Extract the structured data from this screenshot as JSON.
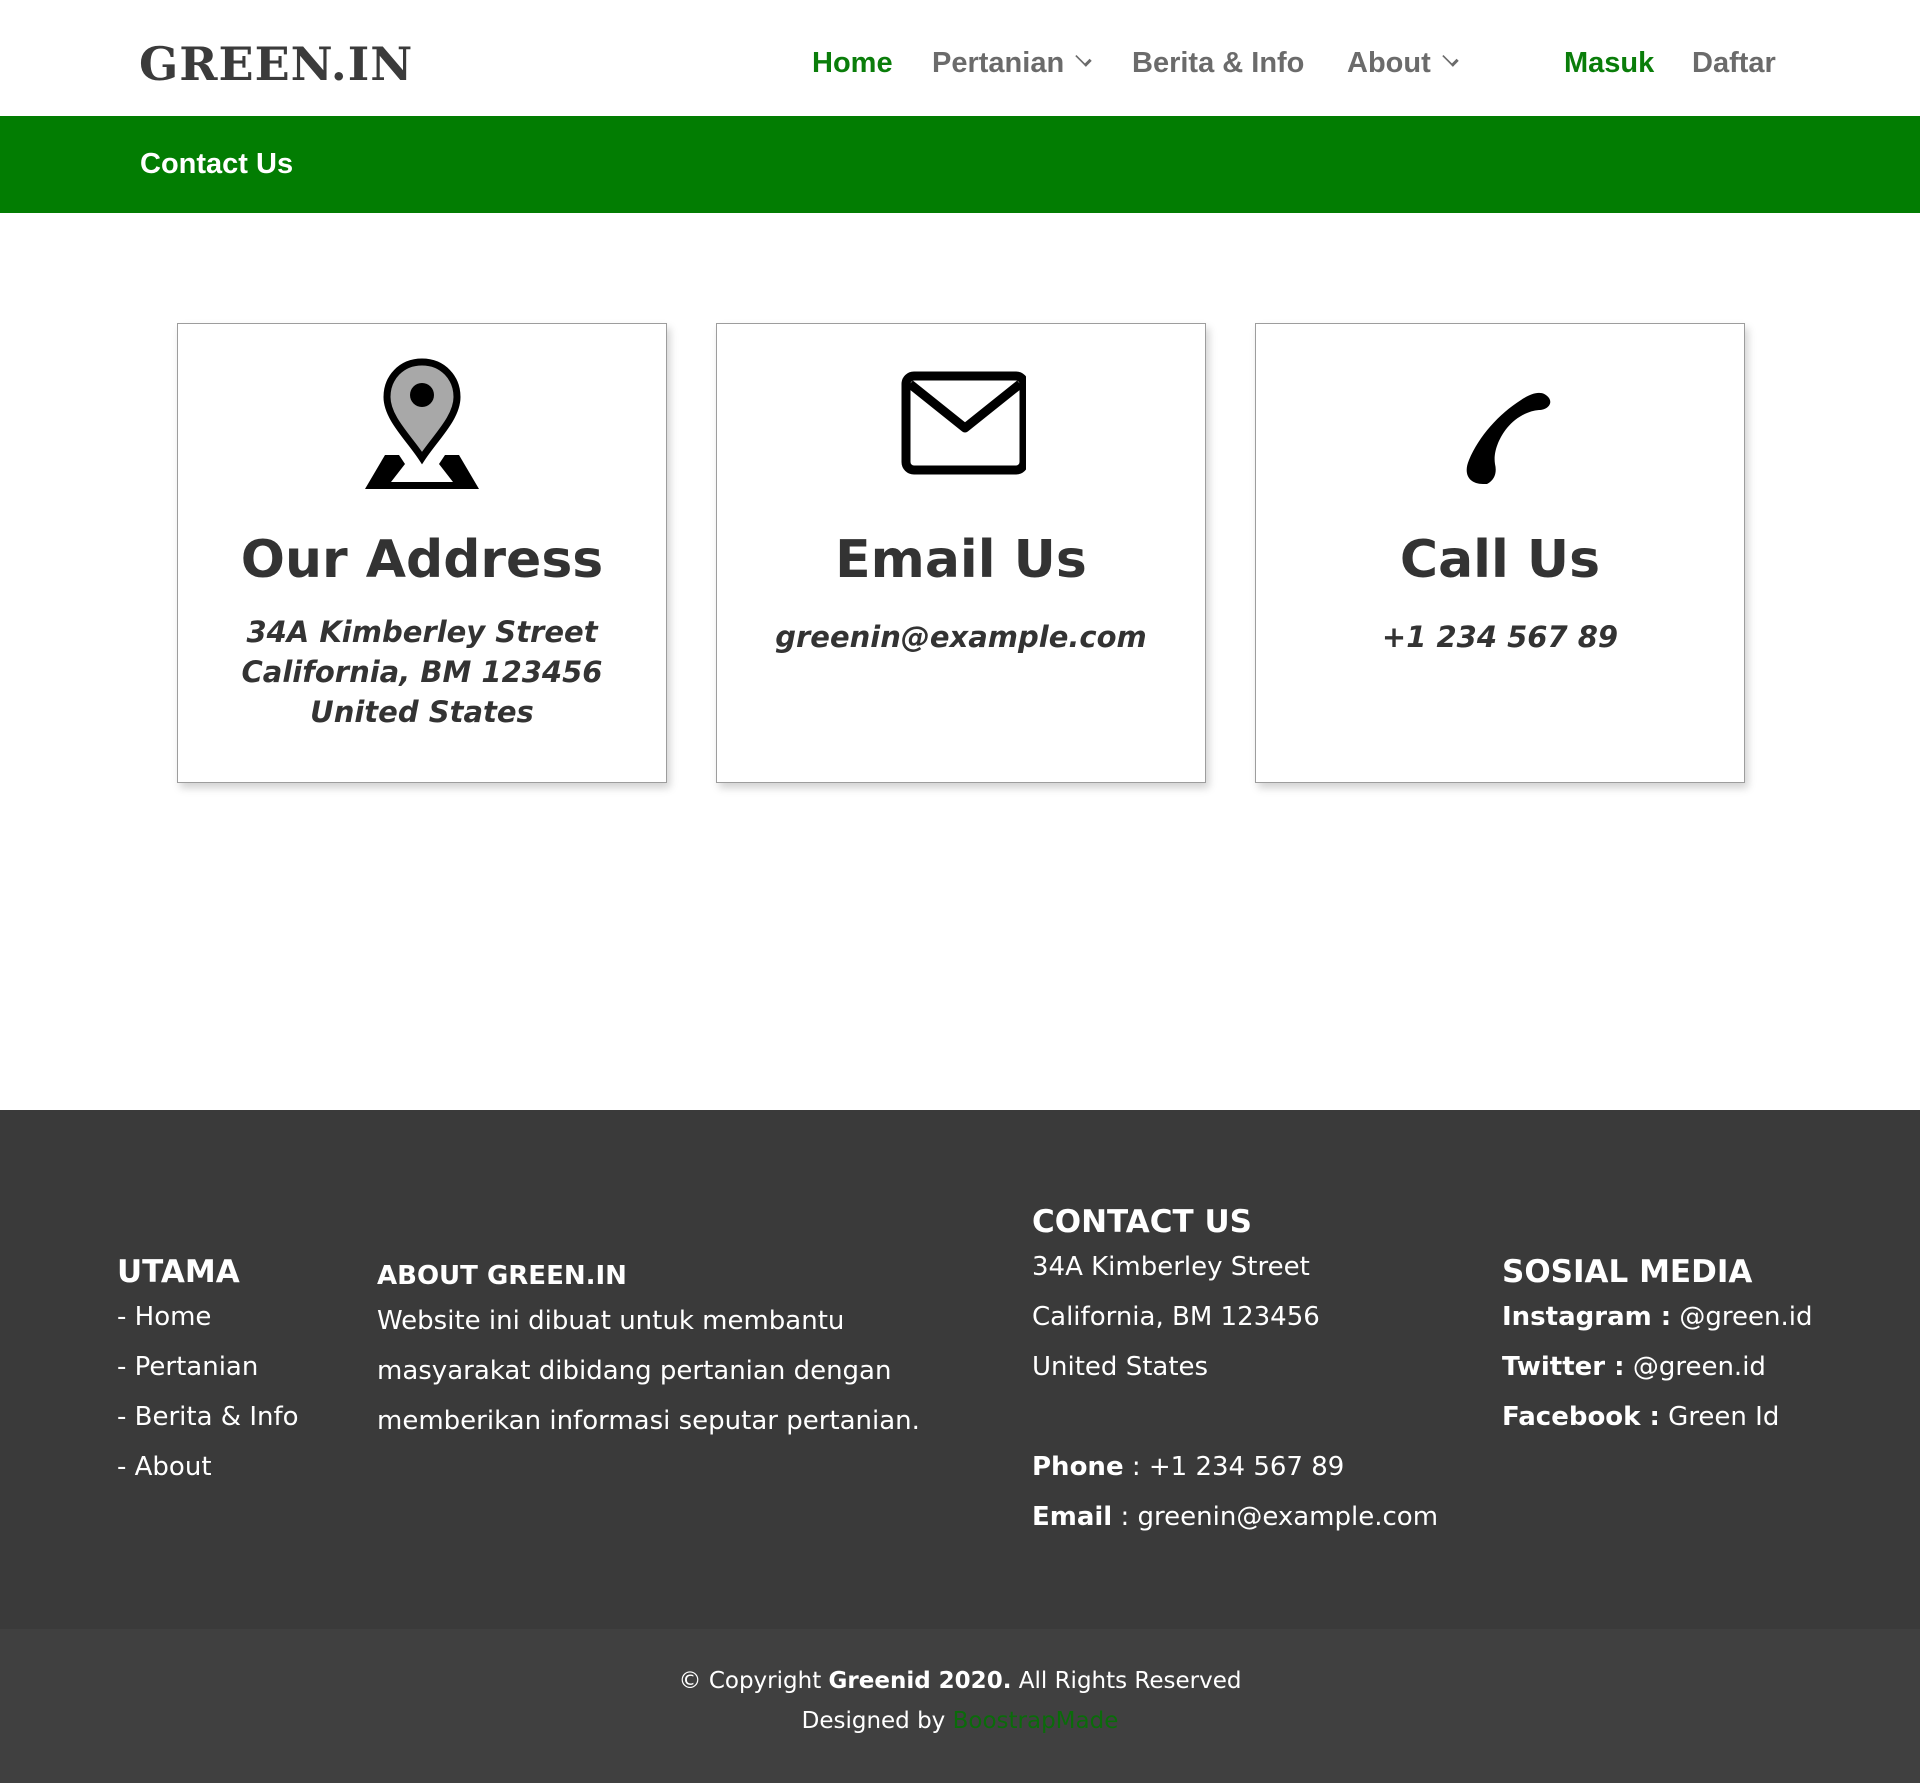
{
  "brand": {
    "logo": "GREEN.IN"
  },
  "nav": {
    "items": [
      {
        "label": "Home",
        "active": true,
        "dropdown": false
      },
      {
        "label": "Pertanian",
        "active": false,
        "dropdown": true
      },
      {
        "label": "Berita & Info",
        "active": false,
        "dropdown": false
      },
      {
        "label": "About",
        "active": false,
        "dropdown": true
      }
    ],
    "auth": {
      "login": "Masuk",
      "register": "Daftar"
    }
  },
  "banner": {
    "title": "Contact Us"
  },
  "cards": [
    {
      "icon": "map-marker-icon",
      "title": "Our Address",
      "lines": [
        "34A Kimberley Street",
        "California, BM 123456",
        "United States"
      ]
    },
    {
      "icon": "envelope-icon",
      "title": "Email Us",
      "lines": [
        "greenin@example.com"
      ]
    },
    {
      "icon": "phone-icon",
      "title": "Call Us",
      "lines": [
        "+1 234 567 89"
      ]
    }
  ],
  "footer": {
    "utama": {
      "heading": "UTAMA",
      "links": [
        "- Home",
        "- Pertanian",
        "- Berita & Info",
        "- About"
      ]
    },
    "about": {
      "heading": "ABOUT GREEN.IN",
      "lines": [
        "Website ini dibuat untuk membantu",
        "masyarakat dibidang pertanian dengan",
        "memberikan informasi seputar pertanian."
      ]
    },
    "contact": {
      "heading": "CONTACT US",
      "address": [
        "34A Kimberley Street",
        "California, BM 123456",
        "United States"
      ],
      "phone_label": "Phone",
      "phone": " : +1 234 567 89",
      "email_label": "Email",
      "email": " : greenin@example.com"
    },
    "social": {
      "heading": "SOSIAL MEDIA",
      "items": [
        {
          "label": "Instagram :",
          "value": " @green.id"
        },
        {
          "label": "Twitter :",
          "value": " @green.id"
        },
        {
          "label": "Facebook :",
          "value": " Green Id"
        }
      ]
    }
  },
  "copyright": {
    "prefix": "© Copyright ",
    "brand": "Greenid 2020.",
    "suffix": " All Rights Reserved",
    "designed_by": "Designed by ",
    "designer": "BoostrapMade"
  },
  "colors": {
    "accent_green": "#027d02",
    "nav_active": "#0a7d0a",
    "footer_bg": "#3a3a3a",
    "copyright_bg": "#404040"
  }
}
